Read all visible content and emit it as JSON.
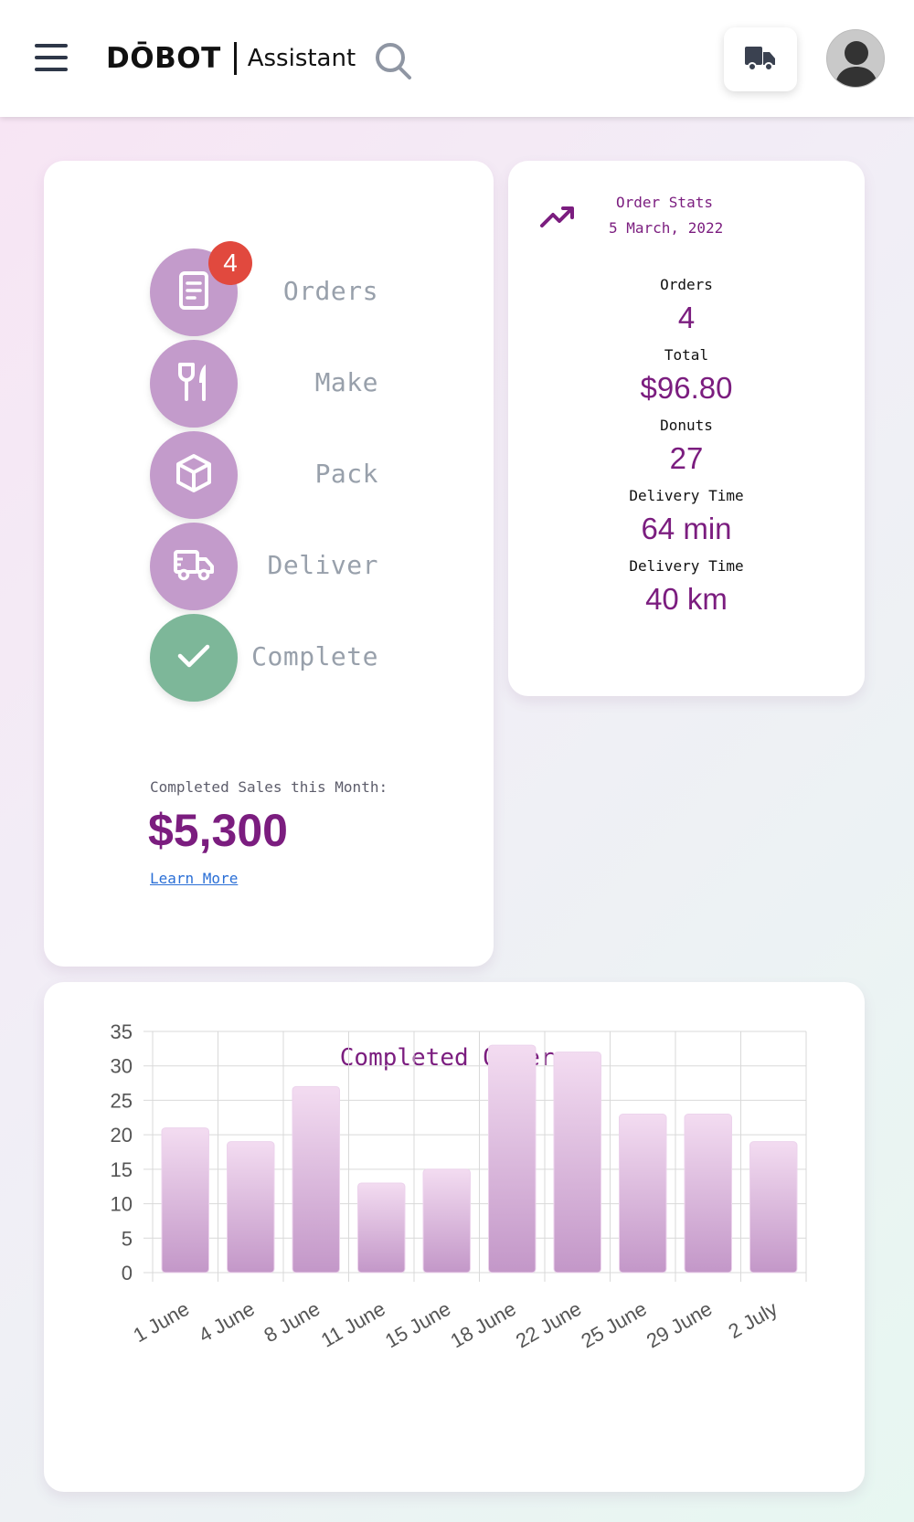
{
  "header": {
    "brand": "DŌBOT",
    "subtitle": "Assistant",
    "menu_icon": "hamburger-menu-icon",
    "search_icon": "search-icon",
    "delivery_icon": "truck-icon",
    "avatar_icon": "user-avatar"
  },
  "workflow": {
    "steps": [
      {
        "label": "Orders",
        "icon": "order-list-icon",
        "badge": "4"
      },
      {
        "label": "Make",
        "icon": "utensils-icon"
      },
      {
        "label": "Pack",
        "icon": "box-icon"
      },
      {
        "label": "Deliver",
        "icon": "delivery-truck-icon"
      },
      {
        "label": "Complete",
        "icon": "checkmark-icon"
      }
    ],
    "sales_label": "Completed Sales this Month:",
    "sales_value": "$5,300",
    "learn_more": "Learn More"
  },
  "stats": {
    "title": "Order Stats",
    "date": "5 March, 2022",
    "icon": "trending-up-icon",
    "items": [
      {
        "label": "Orders",
        "value": "4"
      },
      {
        "label": "Total",
        "value": "$96.80"
      },
      {
        "label": "Donuts",
        "value": "27"
      },
      {
        "label": "Delivery Time",
        "value": "64 min"
      },
      {
        "label": "Delivery Time",
        "value": "40 km"
      }
    ]
  },
  "colors": {
    "accent": "#7b1d7f",
    "step_circle": "#c39bcb",
    "complete_circle": "#7db799",
    "badge": "#e1493e",
    "bar_top": "#f3dcf1",
    "bar_bottom": "#c397c8"
  },
  "chart_data": {
    "type": "bar",
    "title": "Completed Orders",
    "categories": [
      "1 June",
      "4 June",
      "8 June",
      "11 June",
      "15 June",
      "18 June",
      "22 June",
      "25 June",
      "29 June",
      "2 July"
    ],
    "values": [
      21,
      19,
      27,
      13,
      15,
      33,
      32,
      23,
      23,
      19
    ],
    "ylim": [
      0,
      35
    ],
    "yticks": [
      0,
      5,
      10,
      15,
      20,
      25,
      30,
      35
    ],
    "grid": true,
    "xlabel": "",
    "ylabel": ""
  }
}
